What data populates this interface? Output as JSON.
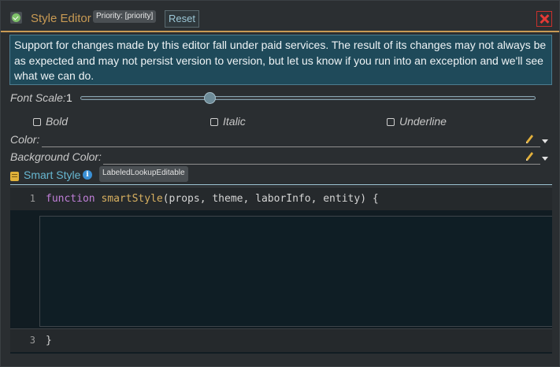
{
  "header": {
    "title": "Style Editor",
    "priority_badge": "Priority: [priority]",
    "reset_label": "Reset",
    "accent_color": "#c89a54"
  },
  "notice": {
    "text": "Support for changes made by this editor fall under paid services. The result of its changes may not always be as expected and may not persist version to version, but let us know if you run into an exception and we'll see what we can do."
  },
  "font_scale": {
    "label": "Font Scale:",
    "value": "1",
    "slider_fraction": 0.28
  },
  "styles": {
    "bold": {
      "label": "Bold",
      "checked": false
    },
    "italic": {
      "label": "Italic",
      "checked": false
    },
    "underline": {
      "label": "Underline",
      "checked": false
    }
  },
  "color_field": {
    "label": "Color:",
    "value": ""
  },
  "background_color_field": {
    "label": "Background Color:",
    "value": ""
  },
  "smart_style": {
    "label": "Smart Style",
    "tooltip": "LabeledLookupEditable",
    "icons": [
      "scroll-icon",
      "info-icon"
    ]
  },
  "editor": {
    "lines": [
      {
        "number": "1",
        "code_keyword": "function",
        "code_name": "smartStyle",
        "code_rest": "(props, theme, laborInfo, entity) {"
      },
      {
        "number": "3",
        "code_rest": "}"
      }
    ]
  }
}
